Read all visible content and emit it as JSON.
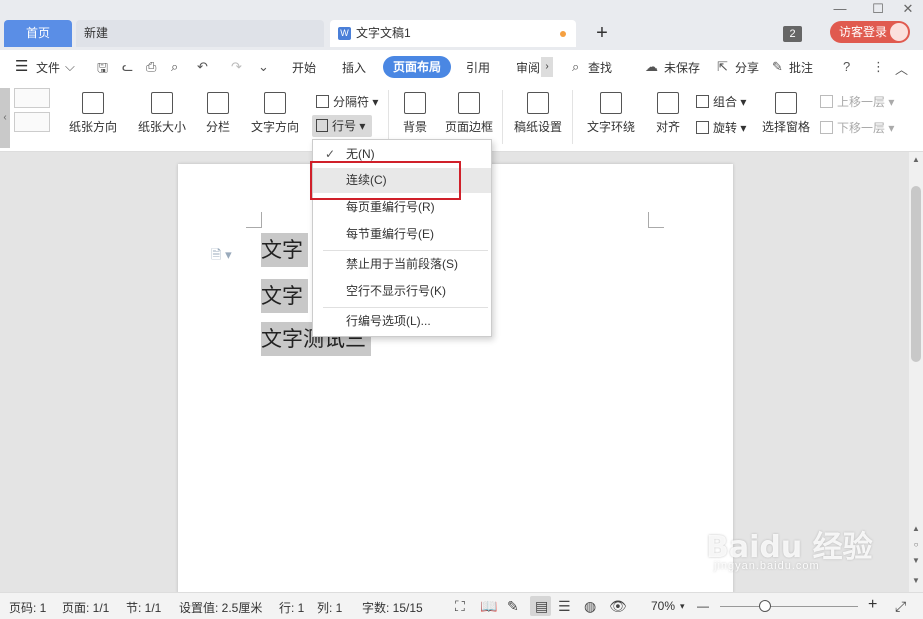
{
  "tabs": {
    "home": "首页",
    "new": "新建",
    "doc": "文字文稿1",
    "doc_icon": "W",
    "plus": "+",
    "window_count": "2",
    "login": "访客登录"
  },
  "menu": {
    "file": "文件",
    "start": "开始",
    "insert": "插入",
    "page_layout": "页面布局",
    "reference": "引用",
    "review": "审阅",
    "search": "查找",
    "unsaved": "未保存",
    "share": "分享",
    "comment": "批注"
  },
  "ribbon": {
    "paper_direction": "纸张方向",
    "paper_size": "纸张大小",
    "columns": "分栏",
    "text_direction": "文字方向",
    "separator": "分隔符",
    "line_number": "行号",
    "background": "背景",
    "page_border": "页面边框",
    "manuscript": "稿纸设置",
    "text_wrap": "文字环绕",
    "align": "对齐",
    "group": "组合",
    "rotate": "旋转",
    "selection_pane": "选择窗格",
    "bring_forward": "上移一层",
    "send_backward": "下移一层"
  },
  "document": {
    "line1": "文字",
    "line2": "文字",
    "line3": "文字测试三"
  },
  "dropdown": {
    "items": [
      {
        "label": "无(N)",
        "checked": true
      },
      {
        "label": "连续(C)"
      },
      {
        "label": "每页重编行号(R)"
      },
      {
        "label": "每节重编行号(E)"
      },
      {
        "label": "禁止用于当前段落(S)"
      },
      {
        "label": "空行不显示行号(K)"
      },
      {
        "label": "行编号选项(L)..."
      }
    ]
  },
  "status": {
    "page_num": "页码: 1",
    "page": "页面: 1/1",
    "section": "节: 1/1",
    "setting": "设置值: 2.5厘米",
    "row": "行: 1",
    "col": "列: 1",
    "words": "字数: 15/15",
    "zoom": "70%",
    "zoom_minus": "—",
    "zoom_plus": "+"
  },
  "watermark": {
    "brand": "Baidu 经验",
    "url": "jingyan.baidu.com"
  },
  "colors": {
    "accent": "#4a87e3",
    "highlight_border": "#d0202a",
    "login": "#e05a4f"
  }
}
